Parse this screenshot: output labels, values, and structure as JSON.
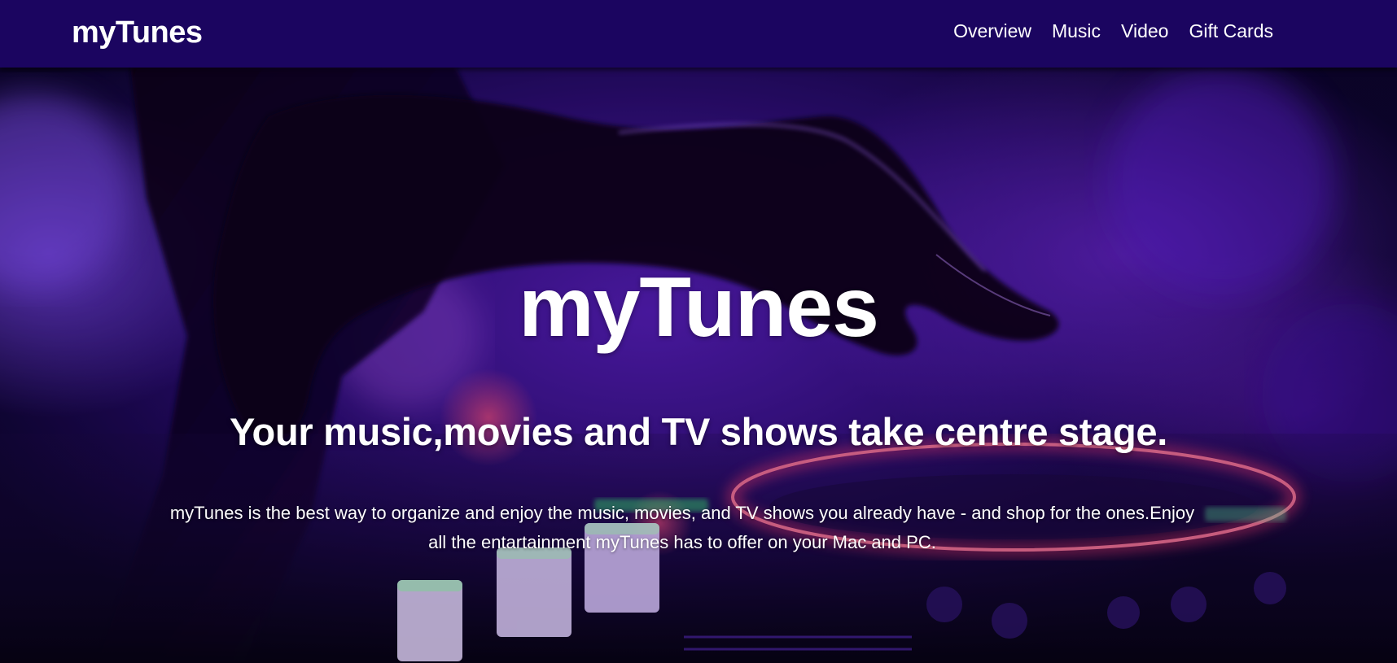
{
  "header": {
    "brand": "myTunes",
    "nav": [
      {
        "label": "Overview"
      },
      {
        "label": "Music"
      },
      {
        "label": "Video"
      },
      {
        "label": "Gift Cards"
      }
    ]
  },
  "hero": {
    "title": "myTunes",
    "subtitle": "Your music,movies and TV shows take centre stage.",
    "description": "myTunes is the best way to organize and enjoy the music, movies, and TV shows you already have - and shop for the ones.Enjoy all the entartainment myTunes has to offer on your Mac and PC."
  },
  "colors": {
    "navbar_bg": "#1b0560",
    "text": "#ffffff",
    "accent_purple": "#6a2bd9",
    "neon_red": "#ff3b6e"
  }
}
